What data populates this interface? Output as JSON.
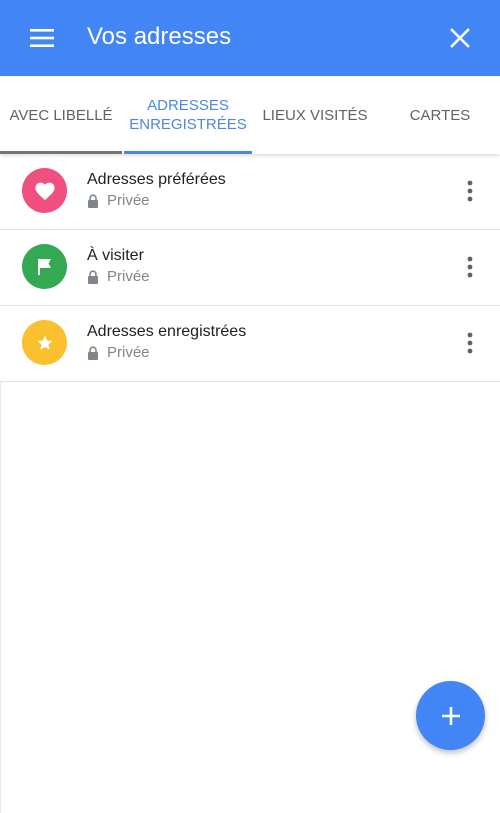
{
  "header": {
    "title": "Vos adresses",
    "menu_icon": "hamburger-menu-icon",
    "close_icon": "close-icon",
    "color": "#4285f4"
  },
  "tabs": [
    {
      "label": "AVEC LIBELLÉ",
      "active": false
    },
    {
      "label": "ADRESSES ENREGISTRÉES",
      "active": true
    },
    {
      "label": "LIEUX VISITÉS",
      "active": false
    },
    {
      "label": "CARTES",
      "active": false
    }
  ],
  "lists": [
    {
      "title": "Adresses préférées",
      "privacy": "Privée",
      "icon": "heart-icon",
      "color": "#f0507f"
    },
    {
      "title": "À visiter",
      "privacy": "Privée",
      "icon": "flag-icon",
      "color": "#34a853"
    },
    {
      "title": "Adresses enregistrées",
      "privacy": "Privée",
      "icon": "star-icon",
      "color": "#fbc02d"
    }
  ],
  "fab": {
    "icon": "plus-icon",
    "color": "#4285f4"
  }
}
